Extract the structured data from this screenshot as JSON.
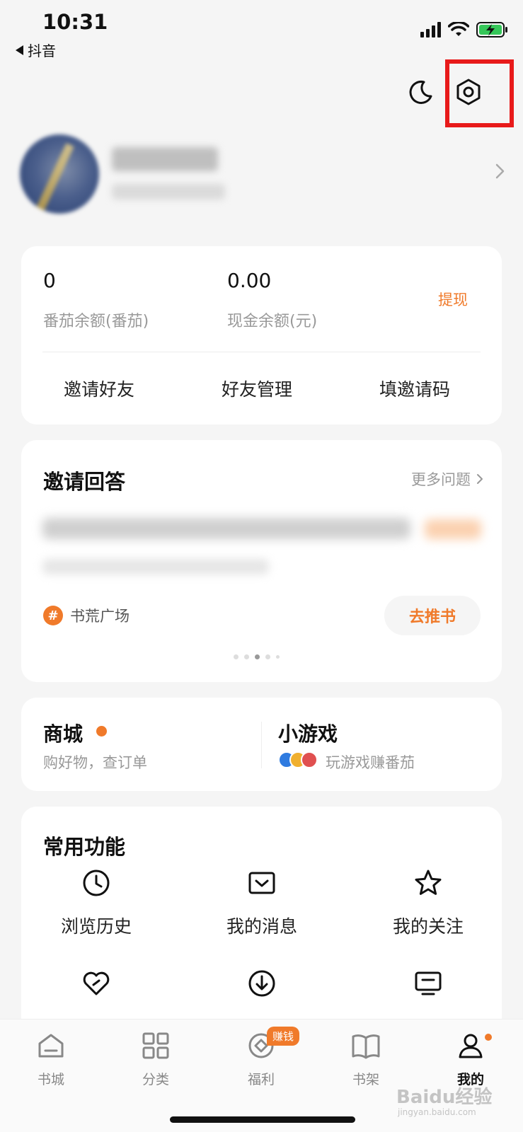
{
  "status_bar": {
    "time": "10:31",
    "back_app": "抖音"
  },
  "profile": {
    "name_blurred": true
  },
  "wallet": {
    "tomato_balance": "0",
    "tomato_label": "番茄余额(番茄)",
    "cash_balance": "0.00",
    "cash_label": "现金余额(元)",
    "withdraw_label": "提现",
    "actions": [
      "邀请好友",
      "好友管理",
      "填邀请码"
    ]
  },
  "invite_answer": {
    "title": "邀请回答",
    "more_label": "更多问题",
    "tag_label": "书荒广场",
    "recommend_button": "去推书"
  },
  "shop": {
    "mall_title": "商城",
    "mall_sub": "购好物，查订单",
    "games_title": "小游戏",
    "games_sub": "玩游戏赚番茄"
  },
  "functions": {
    "title": "常用功能",
    "items": [
      {
        "label": "浏览历史",
        "icon": "clock-icon"
      },
      {
        "label": "我的消息",
        "icon": "message-box-icon"
      },
      {
        "label": "我的关注",
        "icon": "star-icon"
      },
      {
        "label": "",
        "icon": "heart-icon"
      },
      {
        "label": "",
        "icon": "download-icon"
      },
      {
        "label": "",
        "icon": "monitor-icon"
      }
    ]
  },
  "tabbar": {
    "tabs": [
      {
        "label": "书城",
        "icon": "home-icon"
      },
      {
        "label": "分类",
        "icon": "grid-icon"
      },
      {
        "label": "福利",
        "icon": "coin-icon",
        "badge": "赚钱"
      },
      {
        "label": "书架",
        "icon": "book-icon"
      },
      {
        "label": "我的",
        "icon": "person-icon",
        "active": true
      }
    ]
  },
  "watermark": {
    "text": "Baidu经验",
    "sub": "jingyan.baidu.com"
  },
  "colors": {
    "accent": "#f07a2a",
    "highlight": "#e81a1a",
    "background": "#f5f5f5"
  }
}
